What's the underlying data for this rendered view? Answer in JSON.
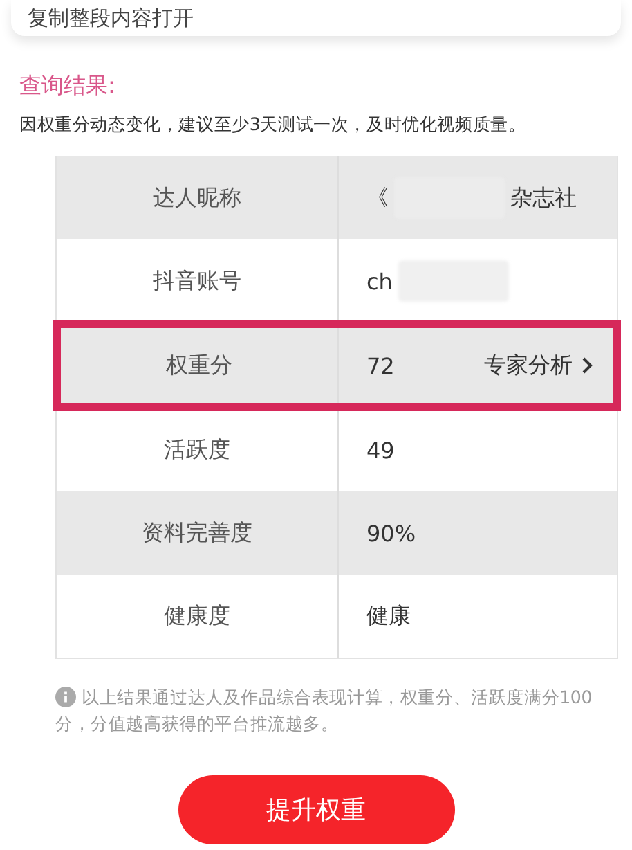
{
  "top_card": {
    "text": "复制整段内容打开"
  },
  "result": {
    "heading": "查询结果:",
    "hint": "因权重分动态变化，建议至少3天测试一次，及时优化视频质量。"
  },
  "table": {
    "rows": [
      {
        "label": "达人昵称",
        "shaded": true,
        "highlighted": false,
        "segments": [
          {
            "kind": "text",
            "text": "《"
          },
          {
            "kind": "redaction"
          },
          {
            "kind": "text",
            "text": "杂志社"
          }
        ]
      },
      {
        "label": "抖音账号",
        "shaded": false,
        "highlighted": false,
        "segments": [
          {
            "kind": "text",
            "text": "ch"
          },
          {
            "kind": "redaction"
          }
        ]
      },
      {
        "label": "权重分",
        "shaded": true,
        "highlighted": true,
        "segments": [
          {
            "kind": "text",
            "text": "72"
          }
        ],
        "link": "专家分析"
      },
      {
        "label": "活跃度",
        "shaded": false,
        "highlighted": false,
        "segments": [
          {
            "kind": "text",
            "text": "49"
          }
        ]
      },
      {
        "label": "资料完善度",
        "shaded": true,
        "highlighted": false,
        "segments": [
          {
            "kind": "text",
            "text": "90%"
          }
        ]
      },
      {
        "label": "健康度",
        "shaded": false,
        "highlighted": false,
        "segments": [
          {
            "kind": "text",
            "text": "健康"
          }
        ]
      }
    ]
  },
  "note": "以上结果通过达人及作品综合表现计算，权重分、活跃度满分100分，分值越高获得的平台推流越多。",
  "button": "提升权重"
}
